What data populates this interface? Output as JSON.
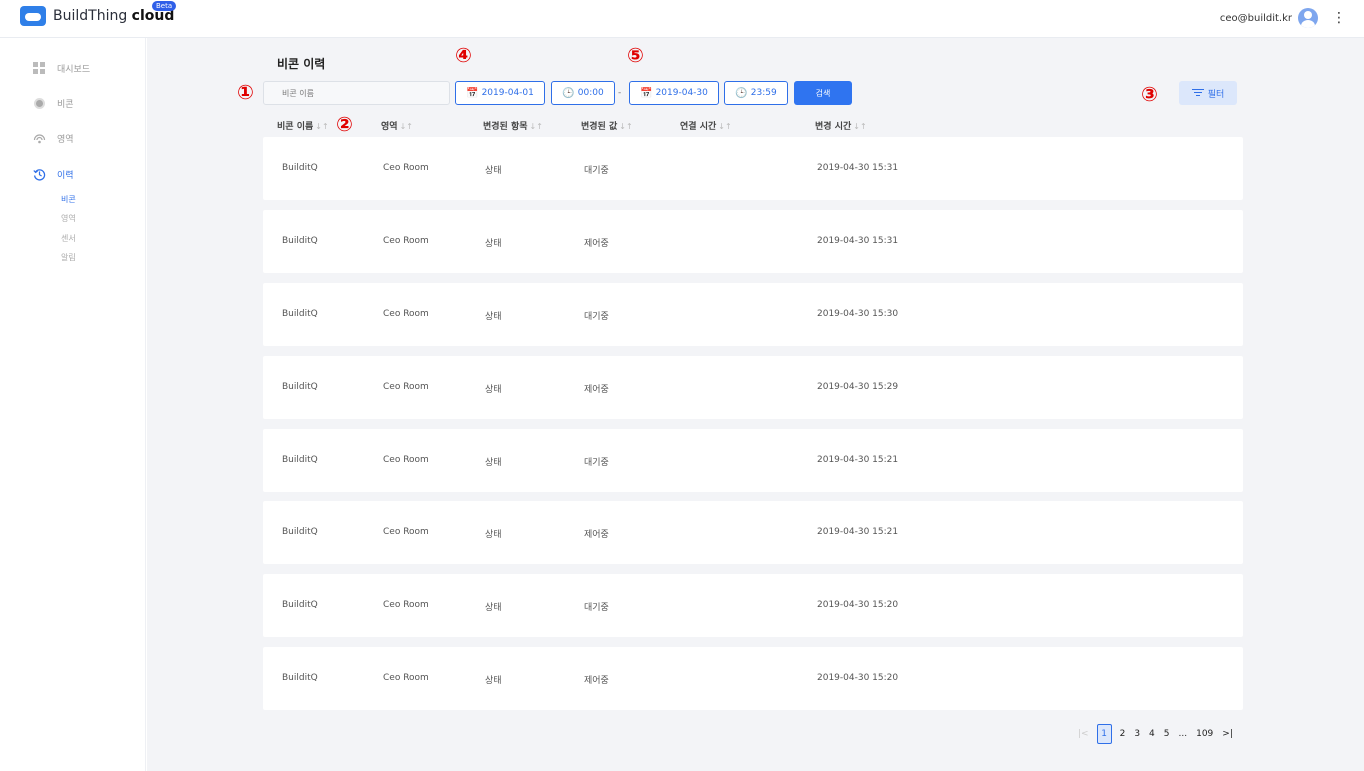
{
  "app": {
    "brand_light": "BuildThing",
    "brand_bold": "cloud",
    "badge": "Beta"
  },
  "user": {
    "email": "ceo@buildit.kr"
  },
  "sidebar": {
    "items": [
      {
        "label": "대시보드",
        "icon": "dashboard-icon"
      },
      {
        "label": "비콘",
        "icon": "beacon-icon"
      },
      {
        "label": "영역",
        "icon": "area-icon"
      },
      {
        "label": "이력",
        "icon": "history-icon"
      }
    ],
    "sub_items": [
      "비콘",
      "영역",
      "센서",
      "알림"
    ]
  },
  "page": {
    "title": "비콘 이력"
  },
  "search": {
    "placeholder": "비콘 이름",
    "start_date": "2019-04-01",
    "start_time": "00:00",
    "separator": "-",
    "end_date": "2019-04-30",
    "end_time": "23:59",
    "search_label": "검색",
    "filter_label": "필터"
  },
  "annotations": [
    "①",
    "②",
    "③",
    "④",
    "⑤"
  ],
  "table": {
    "sort_icon": "↓↑",
    "headers": [
      "비콘 이름",
      "영역",
      "변경된 항목",
      "변경된 값",
      "연결 시간",
      "변경 시간"
    ],
    "rows": [
      [
        "BuilditQ",
        "Ceo Room",
        "상태",
        "대기중",
        "",
        "2019-04-30 15:31"
      ],
      [
        "BuilditQ",
        "Ceo Room",
        "상태",
        "제어중",
        "",
        "2019-04-30 15:31"
      ],
      [
        "BuilditQ",
        "Ceo Room",
        "상태",
        "대기중",
        "",
        "2019-04-30 15:30"
      ],
      [
        "BuilditQ",
        "Ceo Room",
        "상태",
        "제어중",
        "",
        "2019-04-30 15:29"
      ],
      [
        "BuilditQ",
        "Ceo Room",
        "상태",
        "대기중",
        "",
        "2019-04-30 15:21"
      ],
      [
        "BuilditQ",
        "Ceo Room",
        "상태",
        "제어중",
        "",
        "2019-04-30 15:21"
      ],
      [
        "BuilditQ",
        "Ceo Room",
        "상태",
        "대기중",
        "",
        "2019-04-30 15:20"
      ],
      [
        "BuilditQ",
        "Ceo Room",
        "상태",
        "제어중",
        "",
        "2019-04-30 15:20"
      ]
    ]
  },
  "pagination": {
    "first": "|<",
    "pages": [
      "1",
      "2",
      "3",
      "4",
      "5",
      "...",
      "109"
    ],
    "last": ">|",
    "current": "1"
  },
  "colors": {
    "accent": "#2f6fe8",
    "annotation": "#e00000",
    "background": "#f3f4f7"
  }
}
